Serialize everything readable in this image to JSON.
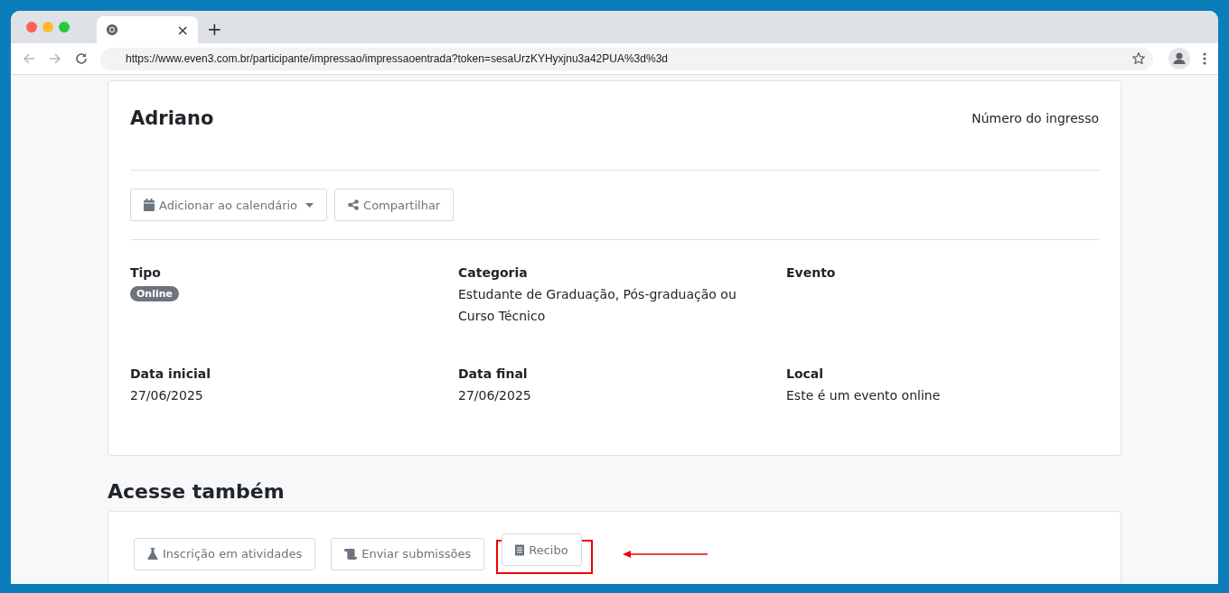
{
  "browser": {
    "tab_close": "×",
    "new_tab": "+",
    "url": "https://www.even3.com.br/participante/impressao/impressaoentrada?token=sesaUrzKYHyxjnu3a42PUA%3d%3d"
  },
  "ticket": {
    "name": "Adriano",
    "number_label": "Número do ingresso",
    "actions": [
      {
        "kind": "dropdown",
        "label": "Adicionar ao calendário"
      },
      {
        "kind": "plain",
        "label": "Compartilhar"
      }
    ],
    "fields": [
      {
        "label": "Tipo",
        "kind": "badge",
        "value": "Online"
      },
      {
        "label": "Categoria",
        "kind": "text",
        "value": "Estudante de Graduação, Pós-graduação ou Curso Técnico"
      },
      {
        "label": "Evento"
      },
      {
        "label": "Data inicial",
        "kind": "text",
        "value": "27/06/2025"
      },
      {
        "label": "Data final",
        "kind": "text",
        "value": "27/06/2025"
      },
      {
        "label": "Local",
        "kind": "text",
        "value": "Este é um evento online"
      }
    ]
  },
  "also": {
    "title": "Acesse também",
    "links": [
      {
        "label": "Inscrição em atividades",
        "highlighted": false
      },
      {
        "label": "Enviar submissões",
        "highlighted": false
      },
      {
        "label": "Recibo",
        "highlighted": true
      }
    ]
  }
}
